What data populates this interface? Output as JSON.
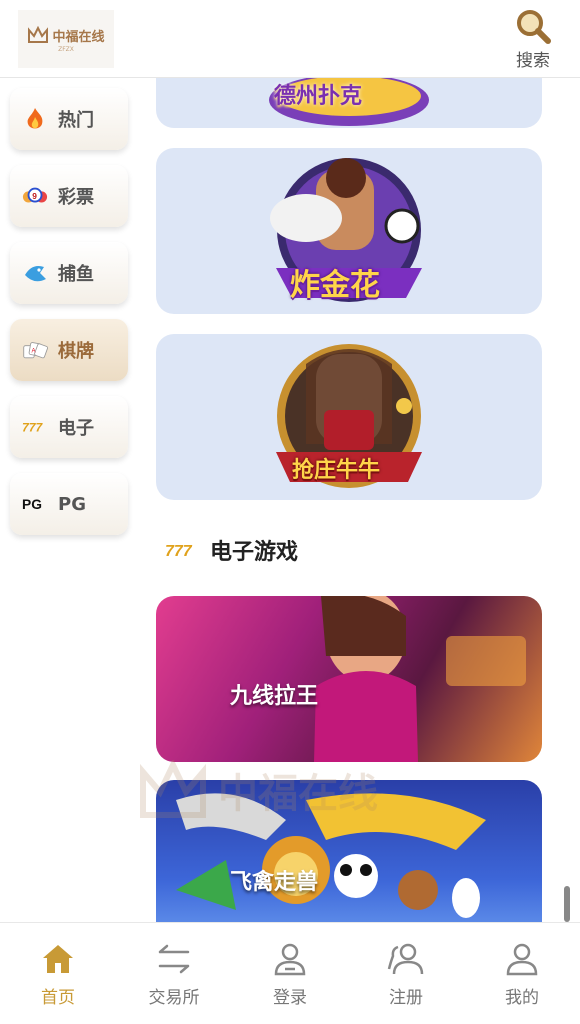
{
  "header": {
    "logo_text": "中福在线",
    "logo_sub": "ZFZX",
    "search_label": "搜索"
  },
  "sidebar": {
    "items": [
      {
        "label": "热门",
        "icon": "flame-icon"
      },
      {
        "label": "彩票",
        "icon": "lottery-ball-icon"
      },
      {
        "label": "捕鱼",
        "icon": "fish-icon"
      },
      {
        "label": "棋牌",
        "icon": "playing-cards-icon",
        "active": true
      },
      {
        "label": "电子",
        "icon": "slot-777-icon"
      },
      {
        "label": "PG",
        "icon": "pg-logo-icon"
      }
    ]
  },
  "games": {
    "poker_cards": [
      {
        "title": "德州扑克"
      },
      {
        "title": "炸金花"
      },
      {
        "title": "抢庄牛牛"
      }
    ],
    "section_title": "电子游戏",
    "slot_cards": [
      {
        "title": "九线拉王"
      },
      {
        "title": "飞禽走兽"
      }
    ]
  },
  "watermark": "中福在线",
  "bottom_nav": {
    "items": [
      {
        "label": "首页",
        "icon": "home-icon",
        "active": true
      },
      {
        "label": "交易所",
        "icon": "exchange-icon"
      },
      {
        "label": "登录",
        "icon": "user-icon"
      },
      {
        "label": "注册",
        "icon": "users-icon"
      },
      {
        "label": "我的",
        "icon": "profile-icon"
      }
    ]
  },
  "colors": {
    "accent": "#c89a36",
    "brand": "#a6774a",
    "poker_card_bg": "#dde6f6"
  }
}
